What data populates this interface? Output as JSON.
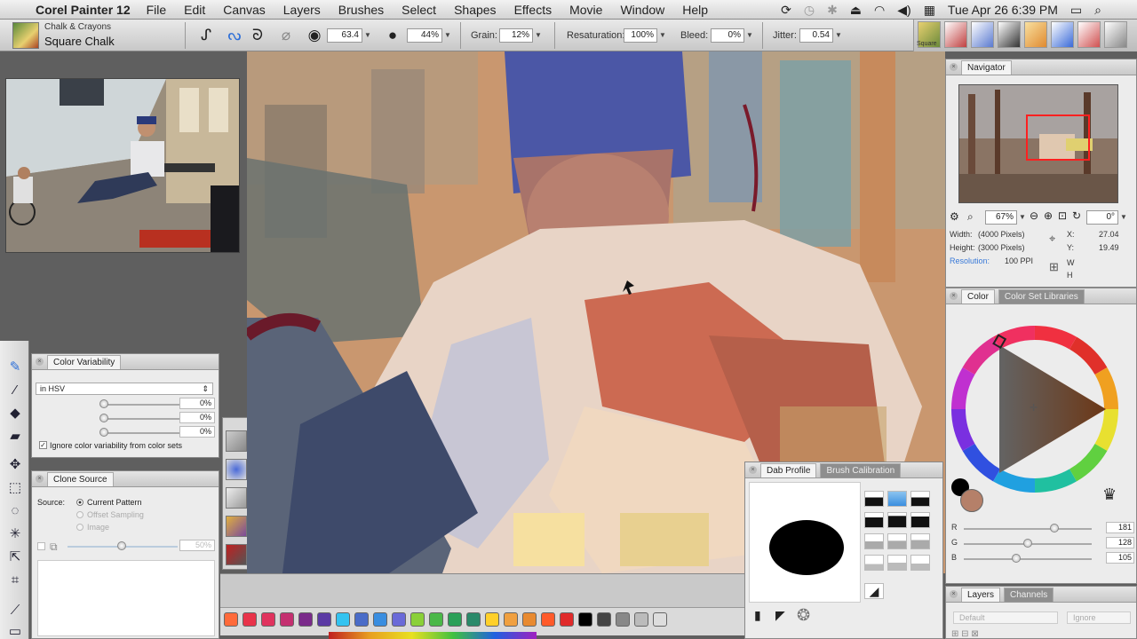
{
  "menubar": {
    "app_name": "Corel Painter 12",
    "items": [
      "File",
      "Edit",
      "Canvas",
      "Layers",
      "Brushes",
      "Select",
      "Shapes",
      "Effects",
      "Movie",
      "Window",
      "Help"
    ],
    "clock": "Tue Apr 26  6:39 PM"
  },
  "brush": {
    "category": "Chalk & Crayons",
    "variant": "Square Chalk",
    "size": "63.4",
    "opacity": "44%",
    "grain_label": "Grain:",
    "grain": "12%",
    "resaturation_label": "Resaturation:",
    "resaturation": "100%",
    "bleed_label": "Bleed:",
    "bleed": "0%",
    "jitter_label": "Jitter:",
    "jitter": "0.54"
  },
  "brush_strip": {
    "first_label": "Square"
  },
  "color_variability": {
    "title": "Color Variability",
    "mode": "in HSV",
    "values": [
      "0%",
      "0%",
      "0%"
    ],
    "ignore_label": "Ignore color variability from color sets"
  },
  "clone_source": {
    "title": "Clone Source",
    "source_label": "Source:",
    "options": [
      "Current Pattern",
      "Offset Sampling",
      "Image"
    ],
    "opacity": "50%"
  },
  "navigator": {
    "title": "Navigator",
    "zoom": "67%",
    "rotation": "0°",
    "width_label": "Width:",
    "width": "(4000 Pixels)",
    "height_label": "Height:",
    "height": "(3000 Pixels)",
    "resolution_label": "Resolution:",
    "resolution": "100 PPI",
    "x_label": "X:",
    "x": "27.04",
    "y_label": "Y:",
    "y": "19.49",
    "w_label": "W",
    "h_label": "H"
  },
  "color_panel": {
    "tabs": [
      "Color",
      "Color Set Libraries"
    ],
    "r_label": "R",
    "r": "181",
    "r_level": 0.71,
    "g_label": "G",
    "g": "128",
    "g_level": 0.5,
    "b_label": "B",
    "b": "105",
    "b_level": 0.41,
    "main_color": "#b58069",
    "secondary_color": "#000000"
  },
  "dab_profile": {
    "tabs": [
      "Dab Profile",
      "Brush Calibration"
    ]
  },
  "layers": {
    "tabs": [
      "Layers",
      "Channels"
    ],
    "composite": "Default",
    "preserve": "Ignore"
  },
  "color_set": {
    "swatches": [
      "#ff6a3a",
      "#e8334a",
      "#e0335e",
      "#c43070",
      "#7a2a8a",
      "#5b3aa4",
      "#33c3f0",
      "#4a6cc8",
      "#3a8ee0",
      "#6a6ad8",
      "#8ad038",
      "#4ab848",
      "#2aa058",
      "#2a8a6a",
      "#ffd02a",
      "#f0a040",
      "#e88a30",
      "#ff5a2a",
      "#e02a2a",
      "#000000",
      "#444444",
      "#888888",
      "#bbbbbb",
      "#dddddd"
    ]
  }
}
